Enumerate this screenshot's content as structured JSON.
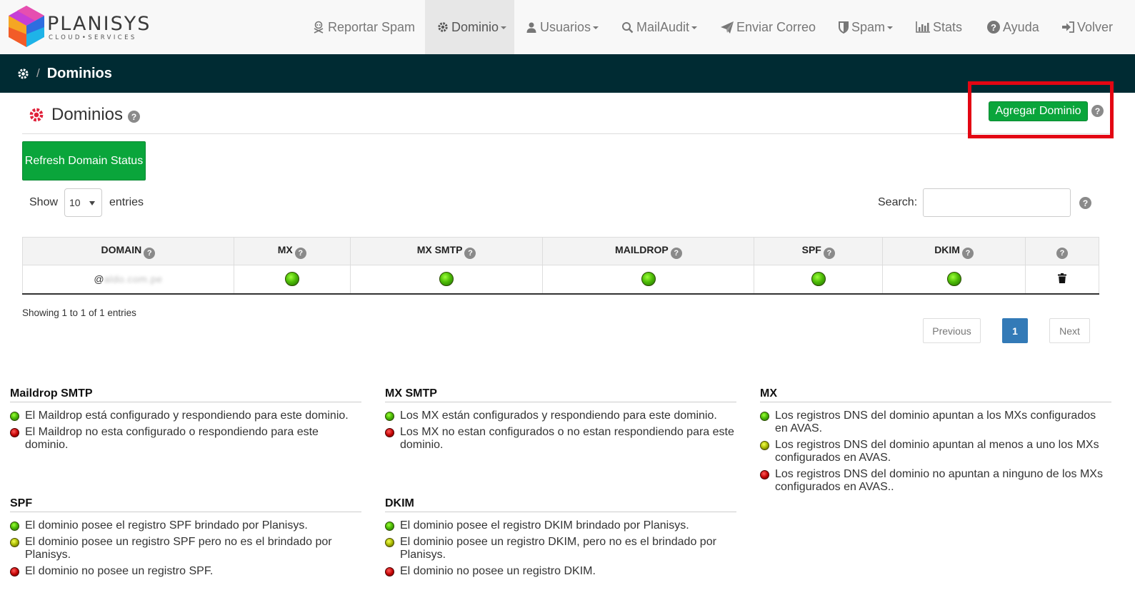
{
  "brand": {
    "name": "PLANISYS",
    "tagline": "CLOUD•SERVICES"
  },
  "nav": [
    {
      "label": "Reportar Spam",
      "icon": "skull-crossbones-icon",
      "dropdown": false
    },
    {
      "label": "Dominio",
      "icon": "gear-icon",
      "dropdown": true,
      "active": true
    },
    {
      "label": "Usuarios",
      "icon": "user-icon",
      "dropdown": true
    },
    {
      "label": "MailAudit",
      "icon": "search-icon",
      "dropdown": true
    },
    {
      "label": "Enviar Correo",
      "icon": "paper-plane-icon",
      "dropdown": false
    },
    {
      "label": "Spam",
      "icon": "shield-icon",
      "dropdown": true
    },
    {
      "label": "Stats",
      "icon": "bar-chart-icon",
      "dropdown": false
    },
    {
      "label": "Ayuda",
      "icon": "question-circle-icon",
      "dropdown": false
    },
    {
      "label": "Volver",
      "icon": "sign-in-icon",
      "dropdown": false
    }
  ],
  "breadcrumb": {
    "separator": "/",
    "current": "Dominios"
  },
  "page": {
    "title": "Dominios",
    "help": "?"
  },
  "buttons": {
    "add_domain": "Agregar Dominio",
    "refresh": "Refresh Domain Status"
  },
  "controls": {
    "show_label": "Show",
    "page_size": "10",
    "entries_label": "entries",
    "search_label": "Search:",
    "search_value": ""
  },
  "table": {
    "columns": [
      "DOMAIN",
      "MX",
      "MX SMTP",
      "MAILDROP",
      "SPF",
      "DKIM",
      ""
    ],
    "rows": [
      {
        "domain_prefix": "@",
        "domain_blurred": "aldo.com.pe",
        "mx": "green",
        "mx_smtp": "green",
        "maildrop": "green",
        "spf": "green",
        "dkim": "green",
        "action_icon": "trash-icon"
      }
    ]
  },
  "info": "Showing 1 to 1 of 1 entries",
  "pagination": {
    "previous": "Previous",
    "current": "1",
    "next": "Next"
  },
  "colors": {
    "accent_green": "#0aa53b",
    "navbar_dark": "#002b33",
    "highlight_red": "#e30613",
    "page_blue": "#337ab7"
  },
  "legend": {
    "maildrop": {
      "title": "Maildrop SMTP",
      "items": [
        {
          "status": "green",
          "text": "El Maildrop está configurado y respondiendo para este dominio."
        },
        {
          "status": "red",
          "text": "El Maildrop no esta configurado o respondiendo para este dominio."
        }
      ]
    },
    "mx_smtp": {
      "title": "MX SMTP",
      "items": [
        {
          "status": "green",
          "text": "Los MX están configurados y respondiendo para este dominio."
        },
        {
          "status": "red",
          "text": "Los MX no estan configurados o no estan respondiendo para este dominio."
        }
      ]
    },
    "mx": {
      "title": "MX",
      "items": [
        {
          "status": "green",
          "text": "Los registros DNS del dominio apuntan a los MXs configurados en AVAS."
        },
        {
          "status": "yellow",
          "text": "Los registros DNS del dominio apuntan al menos a uno los MXs configurados en AVAS."
        },
        {
          "status": "red",
          "text": "Los registros DNS del dominio no apuntan a ninguno de los MXs configurados en AVAS.."
        }
      ]
    },
    "spf": {
      "title": "SPF",
      "items": [
        {
          "status": "green",
          "text": "El dominio posee el registro SPF brindado por Planisys."
        },
        {
          "status": "yellow",
          "text": "El dominio posee un registro SPF pero no es el brindado por Planisys."
        },
        {
          "status": "red",
          "text": "El dominio no posee un registro SPF."
        }
      ]
    },
    "dkim": {
      "title": "DKIM",
      "items": [
        {
          "status": "green",
          "text": "El dominio posee el registro DKIM brindado por Planisys."
        },
        {
          "status": "yellow",
          "text": "El dominio posee un registro DKIM, pero no es el brindado por Planisys."
        },
        {
          "status": "red",
          "text": "El dominio no posee un registro DKIM."
        }
      ]
    }
  }
}
